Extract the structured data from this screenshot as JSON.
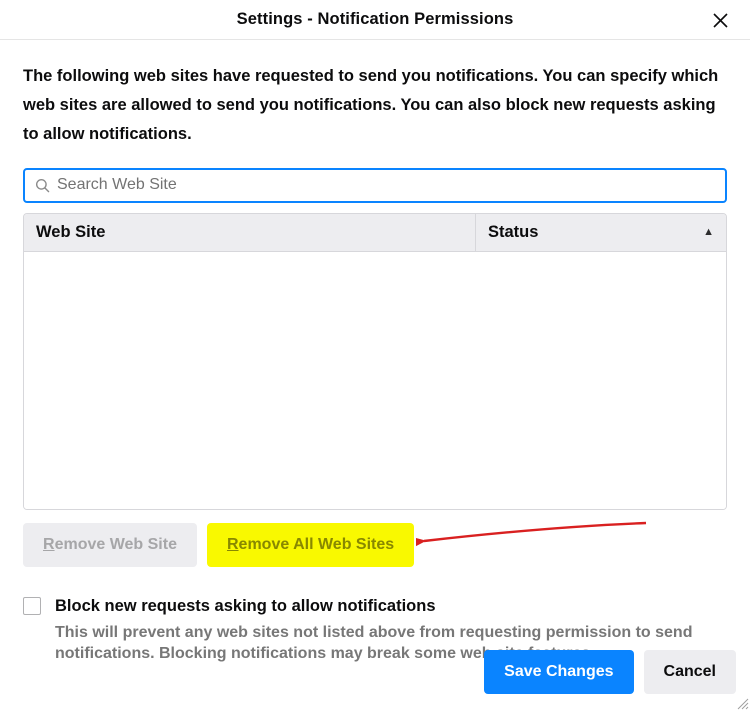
{
  "header": {
    "title": "Settings - Notification Permissions"
  },
  "intro": "The following web sites have requested to send you notifications. You can specify which web sites are allowed to send you notifications. You can also block new requests asking to allow notifications.",
  "search": {
    "placeholder": "Search Web Site",
    "value": ""
  },
  "table": {
    "col_website": "Web Site",
    "col_status": "Status",
    "rows": []
  },
  "buttons": {
    "remove_prefix": "R",
    "remove_rest": "emove Web Site",
    "removeall_prefix": "R",
    "removeall_rest": "emove All Web Sites",
    "save": "Save Changes",
    "cancel": "Cancel"
  },
  "block": {
    "label": "Block new requests asking to allow notifications",
    "checked": false,
    "desc": "This will prevent any web sites not listed above from requesting permission to send notifications. Blocking notifications may break some web site features."
  }
}
